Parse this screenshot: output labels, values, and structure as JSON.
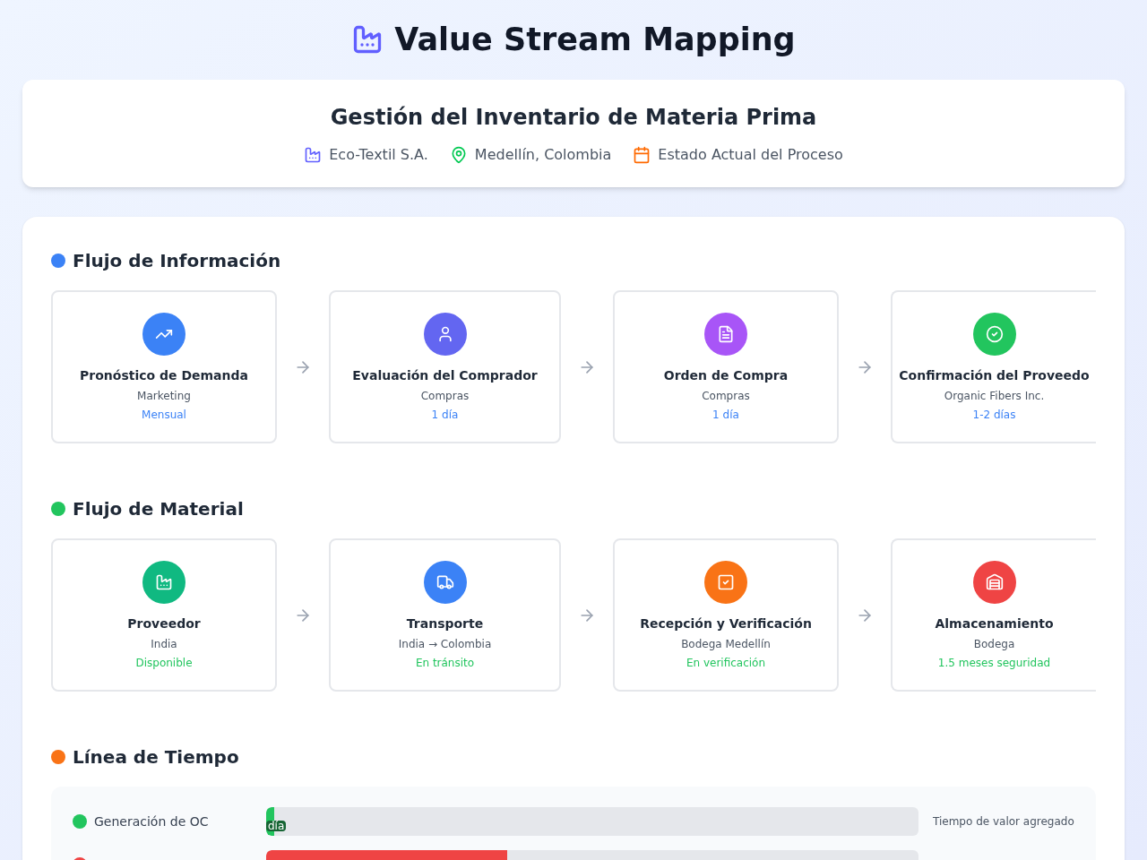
{
  "title": "Value Stream Mapping",
  "header": {
    "title": "Gestión del Inventario de Materia Prima",
    "meta": [
      "Eco-Textil S.A.",
      "Medellín, Colombia",
      "Estado Actual del Proceso"
    ]
  },
  "sections": [
    {
      "title": "Flujo de Información",
      "color": "#3b82f6",
      "steps": [
        {
          "title": "Pronóstico de Demanda",
          "subtitle": "Marketing",
          "detail": "Mensual",
          "color": "#3b82f6"
        },
        {
          "title": "Evaluación del Comprador",
          "subtitle": "Compras",
          "detail": "1 día",
          "color": "#6366f1"
        },
        {
          "title": "Orden de Compra",
          "subtitle": "Compras",
          "detail": "1 día",
          "color": "#a855f7"
        },
        {
          "title": "Confirmación del Proveedo",
          "subtitle": "Organic Fibers Inc.",
          "detail": "1-2 días",
          "color": "#22c55e"
        }
      ]
    },
    {
      "title": "Flujo de Material",
      "color": "#22c55e",
      "steps": [
        {
          "title": "Proveedor",
          "subtitle": "India",
          "detail": "Disponible",
          "color": "#10b981"
        },
        {
          "title": "Transporte",
          "subtitle": "India → Colombia",
          "detail": "En tránsito",
          "color": "#3b82f6"
        },
        {
          "title": "Recepción y Verificación",
          "subtitle": "Bodega Medellín",
          "detail": "En verificación",
          "color": "#f97316"
        },
        {
          "title": "Almacenamiento",
          "subtitle": "Bodega",
          "detail": "1.5 meses seguridad",
          "color": "#ef4444"
        }
      ]
    }
  ],
  "timeline": {
    "title": "Línea de Tiempo",
    "color": "#f97316",
    "rows": [
      {
        "name": "Generación de OC",
        "color": "#22c55e",
        "level": 0.012,
        "bar_label": "día",
        "note": "Tiempo de valor agregado"
      },
      {
        "color": "#ef4444",
        "level": 0.37
      }
    ]
  }
}
